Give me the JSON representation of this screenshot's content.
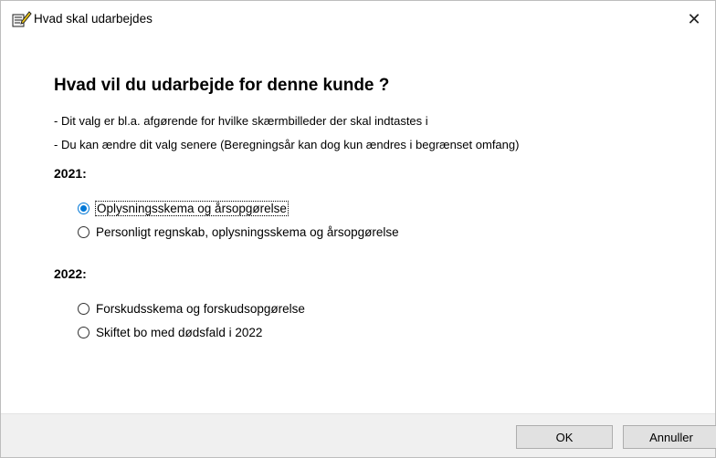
{
  "window": {
    "title": "Hvad skal udarbejdes",
    "close_glyph": "✕"
  },
  "content": {
    "heading": "Hvad vil du udarbejde for denne kunde ?",
    "info_lines": [
      "- Dit valg er bl.a. afgørende for hvilke skærmbilleder der skal indtastes i",
      "- Du kan ændre dit valg senere (Beregningsår kan dog kun ændres i begrænset omfang)"
    ],
    "sections": [
      {
        "title": "2021:",
        "options": [
          {
            "label": "Oplysningsskema og årsopgørelse",
            "selected": true
          },
          {
            "label": "Personligt regnskab, oplysningsskema og årsopgørelse",
            "selected": false
          }
        ]
      },
      {
        "title": "2022:",
        "options": [
          {
            "label": "Forskudsskema og forskudsopgørelse",
            "selected": false
          },
          {
            "label": "Skiftet bo med dødsfald i 2022",
            "selected": false
          }
        ]
      }
    ]
  },
  "footer": {
    "ok_label": "OK",
    "cancel_label": "Annuller"
  },
  "icons": {
    "app": "notepad-edit-icon",
    "close": "close-icon",
    "radio_selected_color": "#0078d7"
  }
}
